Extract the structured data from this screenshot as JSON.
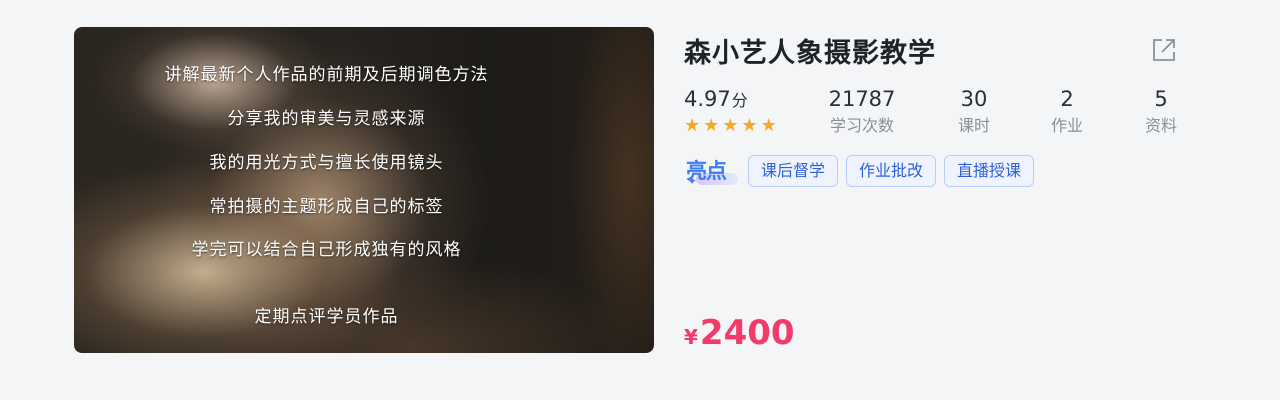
{
  "course": {
    "title": "森小艺人象摄影教学",
    "cover_lines": [
      "讲解最新个人作品的前期及后期调色方法",
      "分享我的审美与灵感来源",
      "我的用光方式与擅长使用镜头",
      "常拍摄的主题形成自己的标签",
      "学完可以结合自己形成独有的风格",
      "定期点评学员作品"
    ]
  },
  "rating": {
    "score": "4.97",
    "unit": "分",
    "stars": 5
  },
  "stats": [
    {
      "value": "21787",
      "label": "学习次数"
    },
    {
      "value": "30",
      "label": "课时"
    },
    {
      "value": "2",
      "label": "作业"
    },
    {
      "value": "5",
      "label": "资料"
    }
  ],
  "highlight_badge": "亮点",
  "tags": [
    "课后督学",
    "作业批改",
    "直播授课"
  ],
  "price": {
    "currency": "¥",
    "value": "2400"
  },
  "icons": {
    "share": "external-link-icon",
    "star": "star-icon",
    "sparkle": "sparkle-icon"
  },
  "colors": {
    "price": "#f23a6b",
    "star": "#f7a823",
    "tag_text": "#2f62d8",
    "tag_border": "#b9cdf7"
  }
}
